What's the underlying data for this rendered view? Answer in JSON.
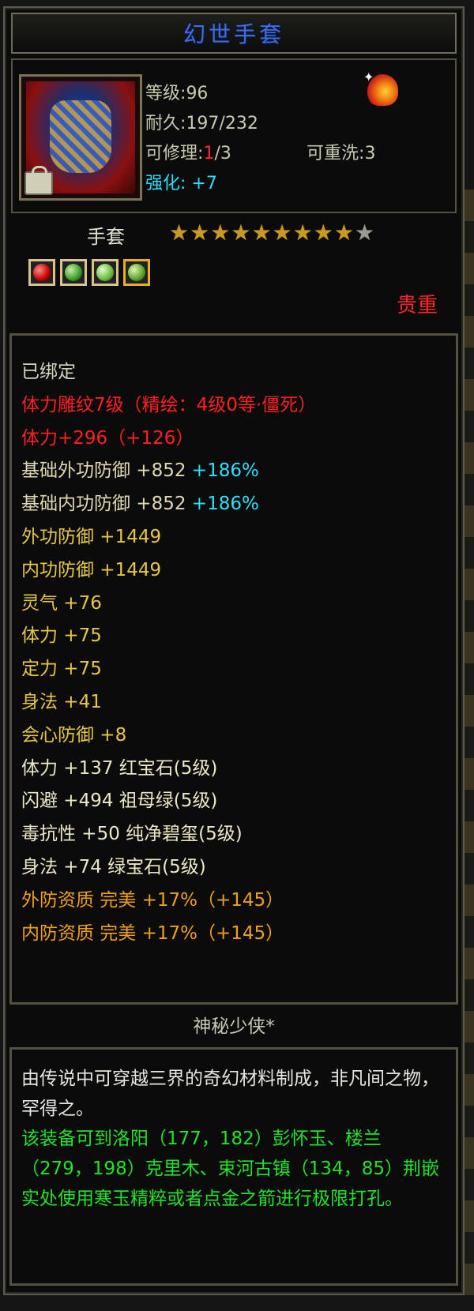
{
  "title": "幻世手套",
  "colors": {
    "title": "#3d6fe0",
    "red": "#ff2020",
    "cyan": "#2ee0ff",
    "yellow": "#e6c740",
    "orange": "#f0a018",
    "green": "#22e22a"
  },
  "icon": {
    "item": "gauntlet-icon",
    "lock": "lock-icon",
    "badge": "flame-icon"
  },
  "header": {
    "level_label": "等级",
    "level_value": "96",
    "durability_label": "耐久",
    "durability_value": "197/232",
    "repair_label": "可修理",
    "repair_current": "1",
    "repair_max": "/3",
    "rewash_label": "可重洗",
    "rewash_value": "3",
    "enhance_label": "强化",
    "enhance_value": "+7"
  },
  "item_type": "手套",
  "stars": {
    "filled": 9,
    "total": 10
  },
  "gems": [
    "ruby-gem-icon",
    "emerald-gem-icon",
    "jade-gem-icon",
    "green-gem-icon"
  ],
  "rarity": "贵重",
  "properties": [
    {
      "text": "已绑定",
      "color": "white"
    },
    {
      "text": "体力雕纹7级（精绘：4级0等·僵死）",
      "color": "red"
    },
    {
      "text": "体力+296（+126）",
      "color": "red"
    },
    {
      "text": "基础外功防御 +852",
      "extra": "+186%",
      "color": "base"
    },
    {
      "text": "基础内功防御 +852",
      "extra": "+186%",
      "color": "base"
    },
    {
      "text": "外功防御 +1449",
      "color": "yellow"
    },
    {
      "text": "内功防御 +1449",
      "color": "yellow"
    },
    {
      "text": "灵气 +76",
      "color": "yellow"
    },
    {
      "text": "体力 +75",
      "color": "yellow"
    },
    {
      "text": "定力 +75",
      "color": "yellow"
    },
    {
      "text": "身法 +41",
      "color": "yellow"
    },
    {
      "text": "会心防御 +8",
      "color": "yellow"
    },
    {
      "text": "体力 +137 红宝石(5级)",
      "color": "gem"
    },
    {
      "text": "闪避 +494 祖母绿(5级)",
      "color": "gem"
    },
    {
      "text": "毒抗性 +50 纯净碧玺(5级)",
      "color": "gem"
    },
    {
      "text": "身法 +74 绿宝石(5级)",
      "color": "gem"
    },
    {
      "text": "外防资质  完美 +17%（+145）",
      "color": "orange"
    },
    {
      "text": "内防资质  完美 +17%（+145）",
      "color": "orange"
    }
  ],
  "maker": "神秘少侠*",
  "description": {
    "lore": "由传说中可穿越三界的奇幻材料制成，非凡间之物，罕得之。",
    "hint": "该装备可到洛阳（177，182）彭怀玉、楼兰（279，198）克里木、束河古镇（134，85）荆嵌实处使用寒玉精粹或者点金之箭进行极限打孔。"
  }
}
